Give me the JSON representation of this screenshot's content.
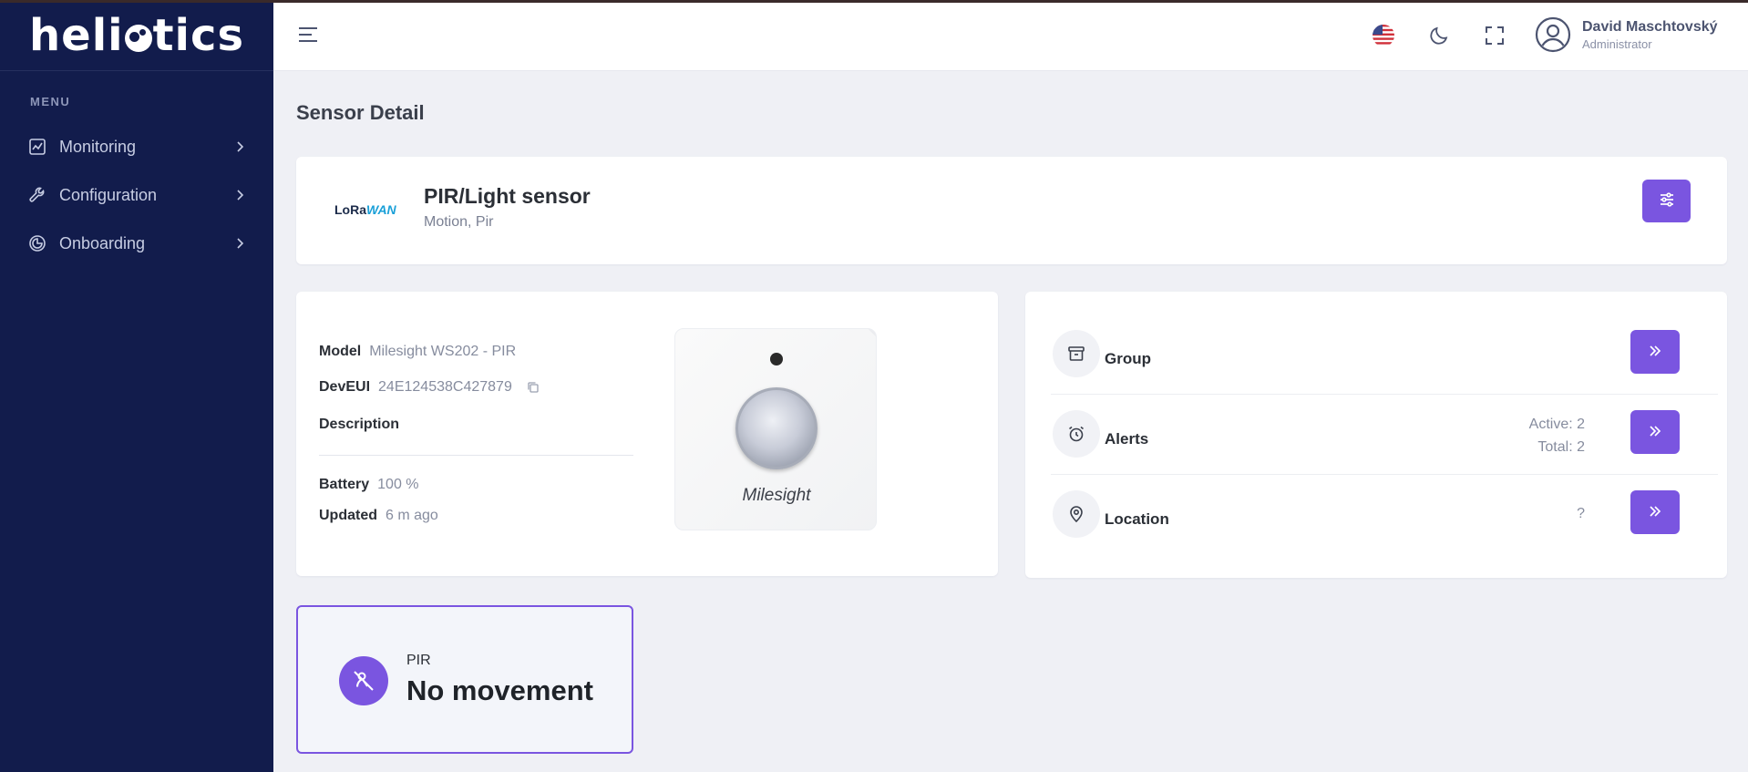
{
  "brand": {
    "logo_left": "heli",
    "logo_right": "tics"
  },
  "sidebar": {
    "menu_label": "MENU",
    "items": [
      {
        "label": "Monitoring",
        "icon": "chart-icon"
      },
      {
        "label": "Configuration",
        "icon": "wrench-icon"
      },
      {
        "label": "Onboarding",
        "icon": "onboarding-icon"
      }
    ]
  },
  "header": {
    "user": {
      "name": "David Maschtovský",
      "role": "Administrator"
    }
  },
  "page": {
    "title": "Sensor Detail"
  },
  "sensor": {
    "protocol_logo_a": "LoRa",
    "protocol_logo_b": "WAN",
    "name": "PIR/Light sensor",
    "tags": "Motion, Pir"
  },
  "info": {
    "model_label": "Model",
    "model_value": "Milesight WS202 - PIR",
    "deveui_label": "DevEUI",
    "deveui_value": "24E124538C427879",
    "description_label": "Description",
    "battery_label": "Battery",
    "battery_value": "100 %",
    "updated_label": "Updated",
    "updated_value": "6 m ago",
    "device_brand": "Milesight"
  },
  "links": {
    "group": {
      "label": "Group"
    },
    "alerts": {
      "label": "Alerts",
      "active": "Active: 2",
      "total": "Total: 2"
    },
    "location": {
      "label": "Location",
      "value": "?"
    }
  },
  "pir": {
    "label": "PIR",
    "value": "No movement"
  },
  "colors": {
    "accent": "#7a55e0",
    "sidebar_bg": "#121c4c",
    "page_bg": "#eff0f5"
  }
}
